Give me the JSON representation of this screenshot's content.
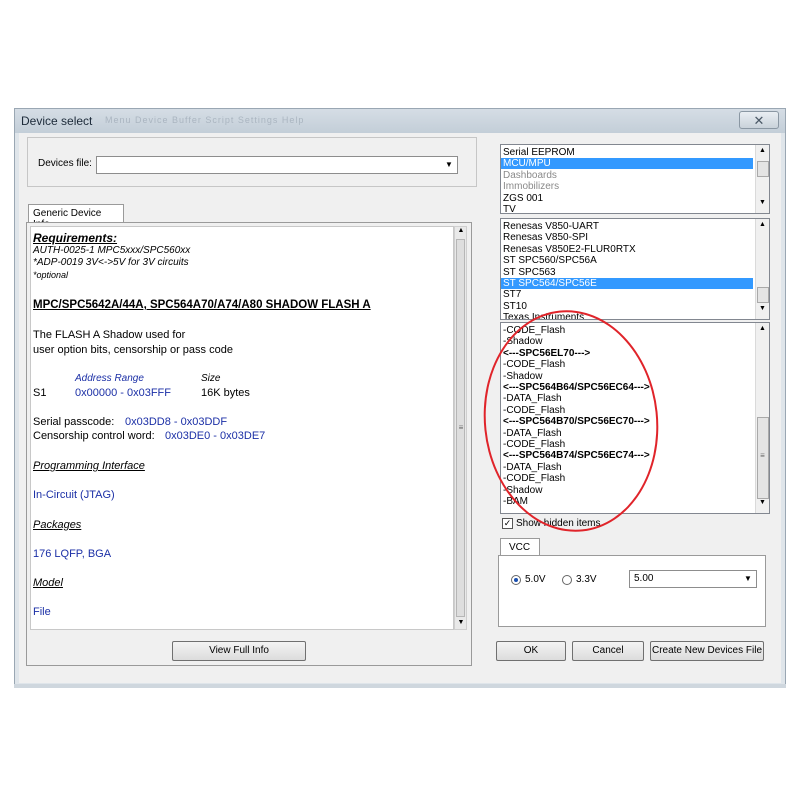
{
  "window": {
    "title": "Device select",
    "title_blur": "Menu  Device  Buffer    Script   Settings   Help    ",
    "close_glyph": "✕"
  },
  "devices_file": {
    "label": "Devices file:",
    "value": ""
  },
  "left_tab": {
    "label": "Generic Device Info"
  },
  "info": {
    "requirements_heading": "Requirements:",
    "req_lines": [
      "AUTH-0025-1 MPC5xxx/SPC560xx",
      "*ADP-0019 3V<->5V for 3V circuits",
      "*optional"
    ],
    "device_heading": "MPC/SPC5642A/44A, SPC564A70/A74/A80 SHADOW FLASH A",
    "desc_lines": [
      "The FLASH A Shadow used for",
      "user option bits, censorship or pass code"
    ],
    "address_range_label": "Address Range",
    "size_label": "Size",
    "s1_label": "S1",
    "s1_range": "0x00000 - 0x03FFF",
    "s1_size": "16K bytes",
    "serial_label": "Serial passcode:",
    "serial_value": "0x03DD8 - 0x03DDF",
    "censor_label": "Censorship control word:",
    "censor_value": "0x03DE0 - 0x03DE7",
    "prog_heading": "Programming Interface",
    "prog_value": "In-Circuit (JTAG)",
    "pkg_heading": "Packages",
    "pkg_value": "176 LQFP, BGA",
    "model_heading": "Model",
    "model_value": "File"
  },
  "view_full_button": "View Full Info",
  "category_list": [
    {
      "label": "Serial EEPROM",
      "state": "normal"
    },
    {
      "label": "MCU/MPU",
      "state": "selected"
    },
    {
      "label": "Dashboards",
      "state": "gray"
    },
    {
      "label": "Immobilizers",
      "state": "gray"
    },
    {
      "label": "ZGS 001",
      "state": "normal"
    },
    {
      "label": "TV",
      "state": "normal"
    }
  ],
  "family_list": [
    {
      "label": "Renesas V850-UART",
      "state": "normal"
    },
    {
      "label": "Renesas V850-SPI",
      "state": "normal"
    },
    {
      "label": "Renesas V850E2-FLUR0RTX",
      "state": "normal"
    },
    {
      "label": "ST SPC560/SPC56A",
      "state": "normal"
    },
    {
      "label": "ST SPC563",
      "state": "normal"
    },
    {
      "label": "ST SPC564/SPC56E",
      "state": "selected"
    },
    {
      "label": "ST7",
      "state": "normal"
    },
    {
      "label": "ST10",
      "state": "normal"
    },
    {
      "label": "Texas Instruments",
      "state": "normal"
    }
  ],
  "device_list": [
    {
      "label": "-CODE_Flash",
      "bold": false
    },
    {
      "label": "-Shadow",
      "bold": false
    },
    {
      "label": "<---SPC56EL70--->",
      "bold": true
    },
    {
      "label": "-CODE_Flash",
      "bold": false
    },
    {
      "label": "-Shadow",
      "bold": false
    },
    {
      "label": "<---SPC564B64/SPC56EC64--->",
      "bold": true
    },
    {
      "label": "-DATA_Flash",
      "bold": false
    },
    {
      "label": "-CODE_Flash",
      "bold": false
    },
    {
      "label": "<---SPC564B70/SPC56EC70--->",
      "bold": true
    },
    {
      "label": "-DATA_Flash",
      "bold": false
    },
    {
      "label": "-CODE_Flash",
      "bold": false
    },
    {
      "label": "<---SPC564B74/SPC56EC74--->",
      "bold": true
    },
    {
      "label": "-DATA_Flash",
      "bold": false
    },
    {
      "label": "-CODE_Flash",
      "bold": false
    },
    {
      "label": "-Shadow",
      "bold": false
    },
    {
      "label": "-BAM",
      "bold": false
    }
  ],
  "show_hidden": {
    "label": "Show hidden items",
    "checked": true,
    "mark": "✓"
  },
  "vcc": {
    "tab_label": "VCC",
    "option_5v": "5.0V",
    "option_33v": "3.3V",
    "selected": "5.0V",
    "combo_value": "5.00"
  },
  "buttons": {
    "ok": "OK",
    "cancel": "Cancel",
    "create": "Create New Devices File"
  },
  "colors": {
    "selection": "#3399ff",
    "info_blue": "#1b2fa6",
    "annotation_red": "#e0242a"
  }
}
